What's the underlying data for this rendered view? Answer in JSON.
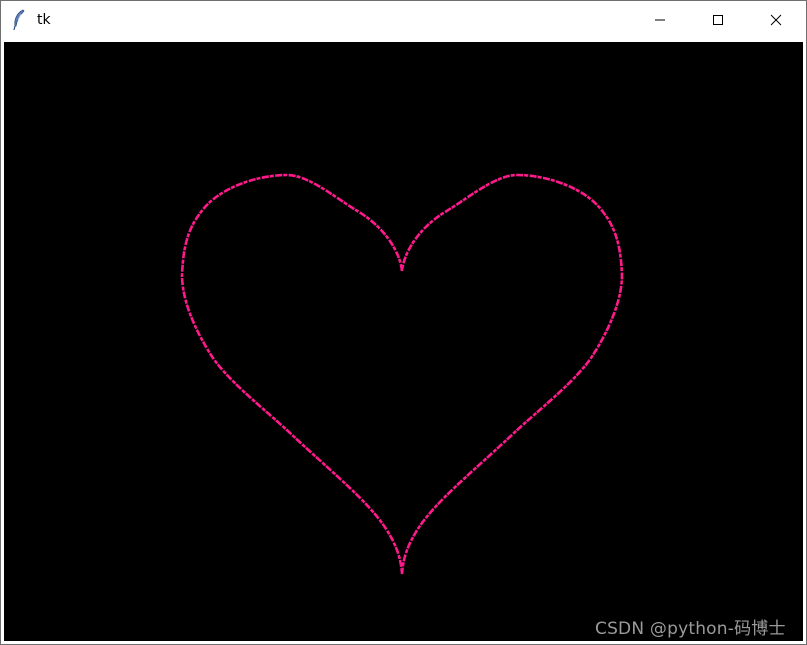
{
  "window": {
    "title": "tk",
    "controls": {
      "minimize_icon": "minimize-icon",
      "maximize_icon": "maximize-icon",
      "close_icon": "close-icon"
    }
  },
  "canvas": {
    "background": "#000000",
    "shape": "heart",
    "stroke_color": "#ff1a8c"
  },
  "watermark": {
    "text": "CSDN @python-码博士"
  }
}
